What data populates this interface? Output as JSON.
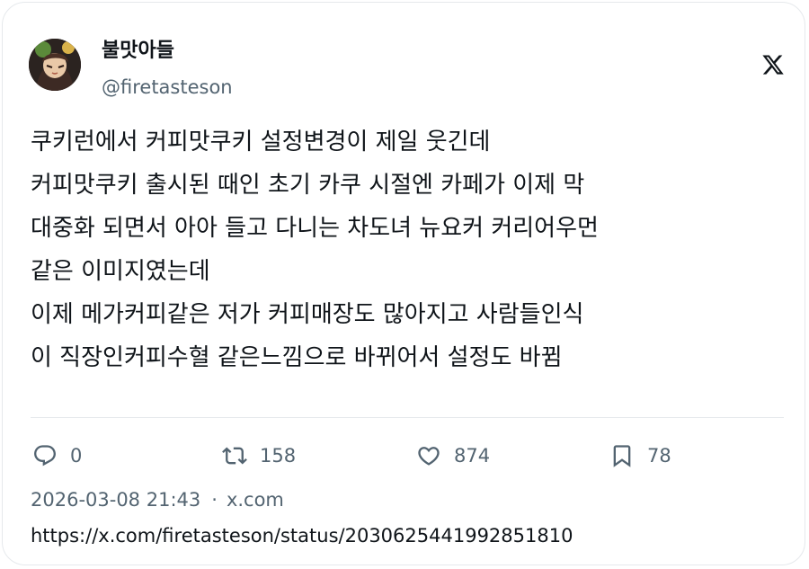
{
  "author": {
    "display_name": "불맛아들",
    "handle": "@firetasteson",
    "avatar_icon": "profile-avatar"
  },
  "brand": {
    "logo_icon": "x-logo-icon"
  },
  "tweet": {
    "lines": [
      "쿠키런에서 커피맛쿠키 설정변경이 제일 웃긴데",
      "커피맛쿠키 출시된 때인 초기 카쿠 시절엔 카페가 이제 막",
      "대중화 되면서 아아 들고 다니는 차도녀 뉴요커 커리어우먼",
      "같은 이미지였는데",
      "이제 메가커피같은 저가 커피매장도 많아지고 사람들인식",
      "이 직장인커피수혈 같은느낌으로 바뀌어서 설정도 바뀜"
    ]
  },
  "actions": {
    "reply": {
      "icon": "reply-icon",
      "count": "0"
    },
    "retweet": {
      "icon": "retweet-icon",
      "count": "158"
    },
    "like": {
      "icon": "heart-icon",
      "count": "874"
    },
    "bookmark": {
      "icon": "bookmark-icon",
      "count": "78"
    }
  },
  "meta": {
    "timestamp": "2026-03-08 21:43",
    "separator": "·",
    "source": "x.com"
  },
  "url": "https://x.com/firetasteson/status/2030625441992851810",
  "colors": {
    "primary_text": "#0f1419",
    "secondary_text": "#536471",
    "border": "#e6e9ec"
  }
}
